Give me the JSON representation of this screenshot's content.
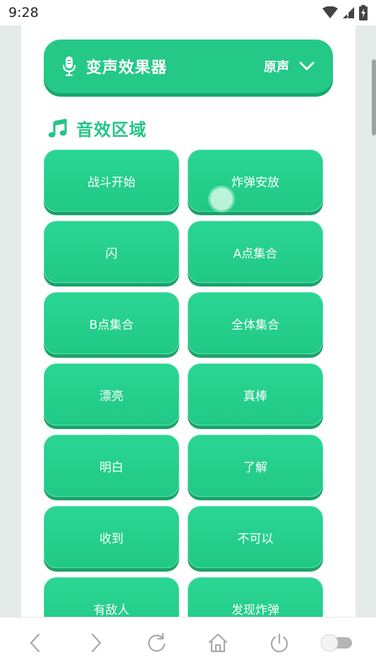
{
  "status": {
    "time": "9:28"
  },
  "voice_changer": {
    "title": "变声效果器",
    "mode": "原声"
  },
  "section": {
    "title": "音效区域"
  },
  "sounds": [
    "战斗开始",
    "炸弹安放",
    "闪",
    "A点集合",
    "B点集合",
    "全体集合",
    "漂亮",
    "真棒",
    "明白",
    "了解",
    "收到",
    "不可以",
    "有敌人",
    "发现炸弹"
  ],
  "icons": {
    "voice": "microphone-icon",
    "dropdown": "chevron-down-icon",
    "section": "music-note-icon",
    "nav": [
      "back-icon",
      "forward-icon",
      "refresh-icon",
      "home-icon",
      "power-icon",
      "toggle-icon"
    ]
  },
  "colors": {
    "accent": "#24c987",
    "accent_dark": "#1aa76e",
    "section_text": "#22c685"
  }
}
